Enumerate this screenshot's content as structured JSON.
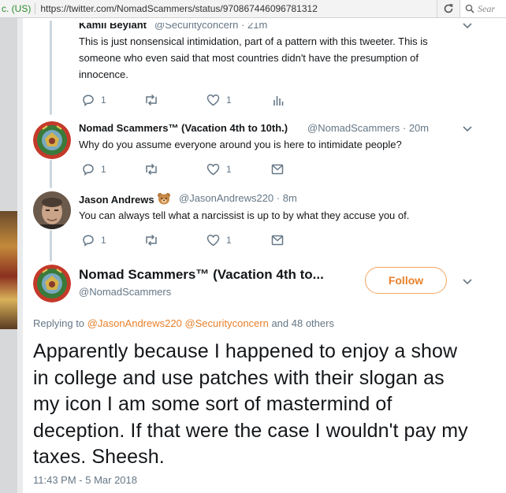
{
  "browser": {
    "ev_label": "c. (US)",
    "url": "https://twitter.com/NomadScammers/status/970867446096781312",
    "search_placeholder": "Sear"
  },
  "tweets": [
    {
      "name": "Kamil Beylant",
      "handle": "@Securityconcern",
      "time": "21m",
      "text": "This is just nonsensical intimidation, part of a pattern with this tweeter.  This is someone who even said that most countries didn't have the presumption of innocence.",
      "reply_count": "1",
      "like_count": "1"
    },
    {
      "name": "Nomad Scammers™ (Vacation 4th to 10th.)",
      "handle": "@NomadScammers",
      "time": "20m",
      "text": "Why do you assume everyone around you is here to intimidate people?",
      "reply_count": "1",
      "like_count": "1"
    },
    {
      "name": "Jason Andrews",
      "handle": "@JasonAndrews220",
      "time": "8m",
      "text": "You can always tell what a narcissist is up to by what they accuse you of.",
      "reply_count": "1",
      "like_count": "1"
    }
  ],
  "main_tweet": {
    "name": "Nomad Scammers™ (Vacation 4th to...",
    "handle": "@NomadScammers",
    "follow_label": "Follow",
    "replying_prefix": "Replying to ",
    "replying_user1": "@JasonAndrews220",
    "replying_user2": "@Securityconcern",
    "replying_suffix": " and 48 others",
    "text": "Apparently because I happened to enjoy a show in college and use patches with their slogan as my icon I am some sort of mastermind of deception. If that were the case I wouldn't pay my taxes. Sheesh.",
    "timestamp": "11:43 PM - 5 Mar 2018"
  },
  "colors": {
    "accent": "#e8802a",
    "meta": "#657786",
    "thread_line": "#ccd6dd"
  }
}
